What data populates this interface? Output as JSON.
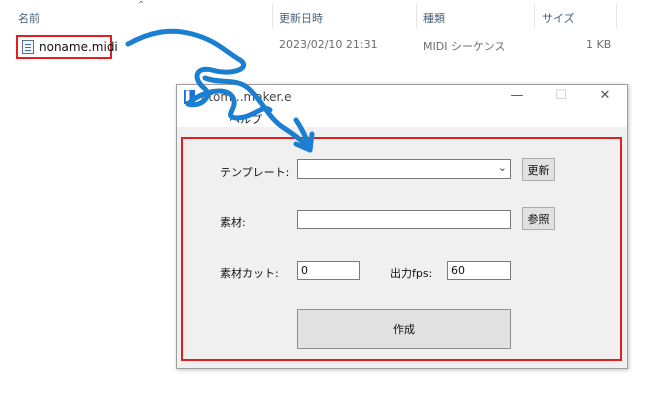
{
  "explorer": {
    "columns": {
      "name": "名前",
      "modified": "更新日時",
      "type": "種類",
      "size": "サイズ"
    },
    "file": {
      "name": "noname.midi",
      "modified": "2023/02/10 21:31",
      "type": "MIDI シーケンス",
      "size": "1 KB"
    }
  },
  "dialog": {
    "title": "otom...maker.e",
    "menu": {
      "help": "ヘルプ"
    },
    "template_label": "テンプレート:",
    "template_value": "",
    "update_button": "更新",
    "material_label": "素材:",
    "material_value": "",
    "browse_button": "参照",
    "material_cut_label": "素材カット:",
    "material_cut_value": "0",
    "output_fps_label": "出力fps:",
    "output_fps_value": "60",
    "create_button": "作成"
  },
  "colors": {
    "highlight": "#e02020",
    "arrow": "#1a7fd0",
    "window_bg": "#f0f0f0"
  }
}
